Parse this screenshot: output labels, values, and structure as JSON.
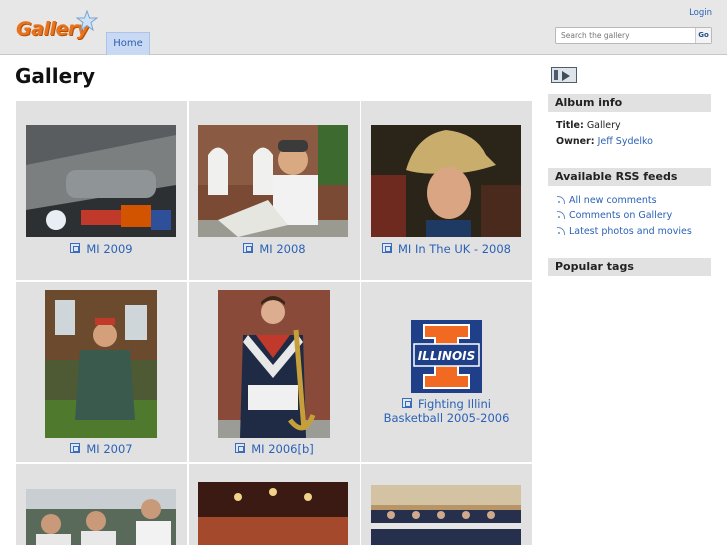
{
  "header": {
    "logo_text": "Gallery",
    "login_label": "Login",
    "search_placeholder": "Search the gallery",
    "search_button": "Go",
    "tab_home": "Home"
  },
  "page": {
    "title": "Gallery"
  },
  "albums": [
    {
      "title": "MI 2009"
    },
    {
      "title": "MI 2008"
    },
    {
      "title": "MI In The UK - 2008"
    },
    {
      "title": "MI 2007"
    },
    {
      "title": "MI 2006[b]"
    },
    {
      "title_line1": "Fighting Illini",
      "title_line2": "Basketball 2005-2006",
      "logo_text": "ILLINOIS"
    }
  ],
  "sidebar": {
    "album_info_heading": "Album info",
    "title_label": "Title:",
    "title_value": "Gallery",
    "owner_label": "Owner:",
    "owner_value": "Jeff Sydelko",
    "rss_heading": "Available RSS feeds",
    "rss_items": [
      "All new comments",
      "Comments on Gallery",
      "Latest photos and movies"
    ],
    "tags_heading": "Popular tags"
  }
}
